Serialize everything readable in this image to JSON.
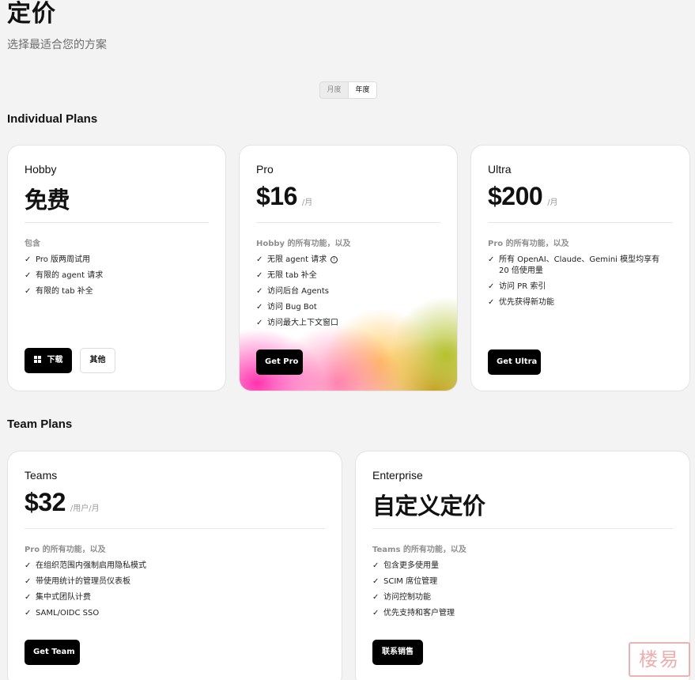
{
  "header": {
    "title": "定价",
    "subtitle": "选择最适合您的方案"
  },
  "billing_toggle": {
    "monthly_label": "月度",
    "yearly_label": "年度",
    "selected": "年度"
  },
  "individual": {
    "section_title": "Individual Plans",
    "hobby": {
      "name": "Hobby",
      "price": "免费",
      "includes": "包含",
      "features": [
        "Pro 版两周试用",
        "有限的 agent 请求",
        "有限的 tab 补全"
      ],
      "primary_button": "下载",
      "secondary_button": "其他"
    },
    "pro": {
      "name": "Pro",
      "price": "$16",
      "unit": "/月",
      "includes": "Hobby 的所有功能，以及",
      "features": [
        "无限 agent 请求",
        "无限 tab 补全",
        "访问后台 Agents",
        "访问 Bug Bot",
        "访问最大上下文窗口"
      ],
      "button": "Get Pro"
    },
    "ultra": {
      "name": "Ultra",
      "price": "$200",
      "unit": "/月",
      "includes": "Pro 的所有功能，以及",
      "features": [
        "所有 OpenAI、Claude、Gemini 模型均享有 20 倍使用量",
        "访问 PR 索引",
        "优先获得新功能"
      ],
      "button": "Get Ultra"
    }
  },
  "team": {
    "section_title": "Team Plans",
    "teams": {
      "name": "Teams",
      "price": "$32",
      "unit": "/用户/月",
      "includes": "Pro 的所有功能，以及",
      "features": [
        "在组织范围内强制启用隐私模式",
        "带使用统计的管理员仪表板",
        "集中式团队计费",
        "SAML/OIDC SSO"
      ],
      "button": "Get Team"
    },
    "enterprise": {
      "name": "Enterprise",
      "price": "自定义定价",
      "includes": "Teams 的所有功能，以及",
      "features": [
        "包含更多使用量",
        "SCIM 席位管理",
        "访问控制功能",
        "优先支持和客户管理"
      ],
      "button": "联系销售"
    }
  },
  "watermark": "楼易",
  "icons": {
    "check": "check-icon",
    "info": "info-circle-icon",
    "windows": "windows-logo-icon"
  }
}
